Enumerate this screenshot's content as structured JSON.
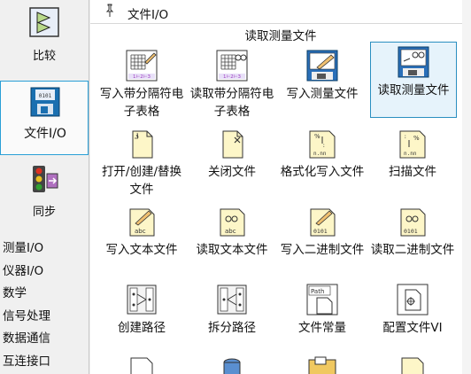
{
  "categories": [
    {
      "label": "比较",
      "icon": "compare-icon",
      "selected": false
    },
    {
      "label": "文件I/O",
      "icon": "floppy-disk-icon",
      "selected": true
    },
    {
      "label": "同步",
      "icon": "traffic-light-icon",
      "selected": false
    }
  ],
  "category_list": [
    "测量I/O",
    "仪器I/O",
    "数学",
    "信号处理",
    "数据通信",
    "互连接口"
  ],
  "palette": {
    "title": "文件I/O",
    "subtitle": "读取测量文件",
    "items": [
      {
        "label": "写入带分隔符电子表格",
        "icon": "write-spreadsheet-icon",
        "selected": false
      },
      {
        "label": "读取带分隔符电子表格",
        "icon": "read-spreadsheet-icon",
        "selected": false
      },
      {
        "label": "写入测量文件",
        "icon": "write-measurement-file-icon",
        "selected": false
      },
      {
        "label": "读取测量文件",
        "icon": "read-measurement-file-icon",
        "selected": true
      },
      {
        "label": "打开/创建/替换文件",
        "icon": "open-create-file-icon",
        "selected": false
      },
      {
        "label": "关闭文件",
        "icon": "close-file-icon",
        "selected": false
      },
      {
        "label": "格式化写入文件",
        "icon": "format-into-file-icon",
        "selected": false
      },
      {
        "label": "扫描文件",
        "icon": "scan-from-file-icon",
        "selected": false
      },
      {
        "label": "写入文本文件",
        "icon": "write-text-file-icon",
        "selected": false
      },
      {
        "label": "读取文本文件",
        "icon": "read-text-file-icon",
        "selected": false
      },
      {
        "label": "写入二进制文件",
        "icon": "write-binary-file-icon",
        "selected": false
      },
      {
        "label": "读取二进制文件",
        "icon": "read-binary-file-icon",
        "selected": false
      },
      {
        "label": "创建路径",
        "icon": "build-path-icon",
        "selected": false
      },
      {
        "label": "拆分路径",
        "icon": "strip-path-icon",
        "selected": false
      },
      {
        "label": "文件常量",
        "icon": "file-constants-icon",
        "selected": false
      },
      {
        "label": "配置文件VI",
        "icon": "config-file-vi-icon",
        "selected": false
      },
      {
        "label": "",
        "icon": "file-icon",
        "selected": false
      },
      {
        "label": "",
        "icon": "database-icon",
        "selected": false
      },
      {
        "label": "",
        "icon": "folder-icon",
        "selected": false
      },
      {
        "label": "",
        "icon": "document-icon",
        "selected": false
      }
    ]
  }
}
